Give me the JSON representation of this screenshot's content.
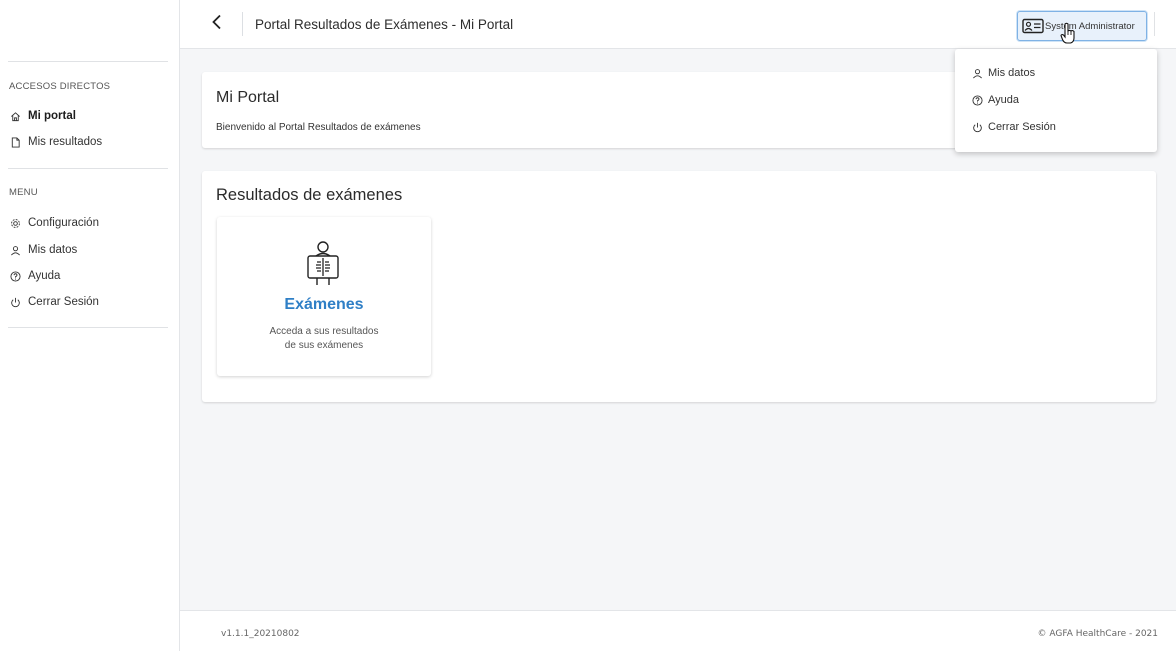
{
  "sidebar": {
    "shortcuts_heading": "ACCESOS DIRECTOS",
    "shortcuts": [
      {
        "label": "Mi portal",
        "icon": "home-icon",
        "active": true
      },
      {
        "label": "Mis resultados",
        "icon": "document-icon",
        "active": false
      }
    ],
    "menu_heading": "MENU",
    "menu": [
      {
        "label": "Configuración",
        "icon": "gear-icon"
      },
      {
        "label": "Mis datos",
        "icon": "user-icon"
      },
      {
        "label": "Ayuda",
        "icon": "help-icon"
      },
      {
        "label": "Cerrar Sesión",
        "icon": "power-icon"
      }
    ]
  },
  "topbar": {
    "title": "Portal Resultados de Exámenes - Mi Portal",
    "user_label": "System Administrator"
  },
  "dropdown": {
    "items": [
      {
        "label": "Mis datos",
        "icon": "user-icon"
      },
      {
        "label": "Ayuda",
        "icon": "help-icon"
      },
      {
        "label": "Cerrar Sesión",
        "icon": "power-icon"
      }
    ]
  },
  "welcome": {
    "title": "Mi Portal",
    "subtitle": "Bienvenido al Portal Resultados de exámenes"
  },
  "results": {
    "title": "Resultados de exámenes",
    "tile": {
      "label": "Exámenes",
      "desc_line1": "Acceda a sus resultados",
      "desc_line2": "de sus exámenes",
      "icon": "xray-icon"
    }
  },
  "footer": {
    "version": "v1.1.1_20210802",
    "copyright": "© AGFA HealthCare - 2021"
  },
  "colors": {
    "accent": "#2f7fc6",
    "background": "#f5f6f8",
    "user_button_bg": "#e8f1fb",
    "user_button_border": "#7fb2e5"
  }
}
